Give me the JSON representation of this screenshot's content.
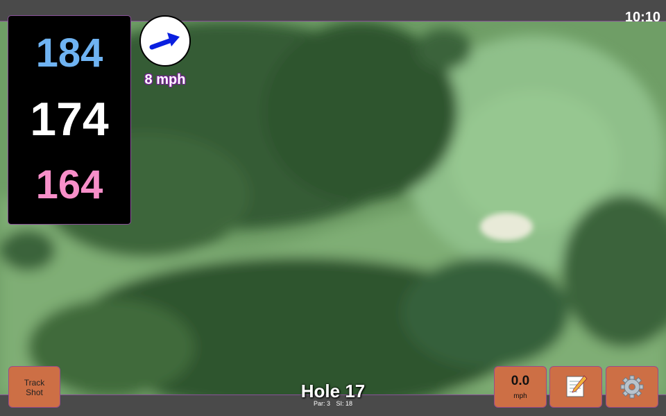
{
  "status_bar": {
    "time": "10:10"
  },
  "distances": {
    "back": "184",
    "center": "174",
    "front": "164"
  },
  "wind": {
    "speed": "8 mph",
    "icon": "wind-arrow-icon"
  },
  "track_button": {
    "line1": "Track",
    "line2": "Shot"
  },
  "speed_button": {
    "value": "0.0",
    "unit": "mph"
  },
  "notes_button": {
    "icon": "notepad-icon"
  },
  "settings_button": {
    "icon": "gear-icon"
  },
  "hole": {
    "title": "Hole 17",
    "par": "Par: 3",
    "si": "SI: 18"
  },
  "colors": {
    "back": "#6fb3f2",
    "center": "#ffffff",
    "front": "#f78fc9",
    "button": "#cd6f45",
    "accent": "#8a4f9a"
  }
}
